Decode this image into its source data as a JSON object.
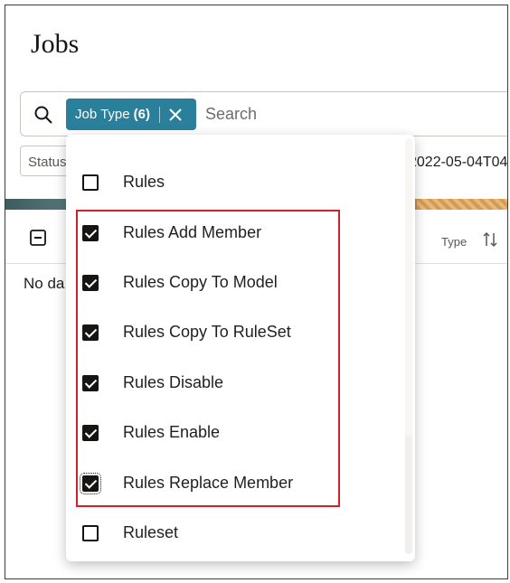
{
  "page": {
    "title": "Jobs"
  },
  "search": {
    "chip_label": "Job Type",
    "chip_count": "(6)",
    "placeholder": "Search"
  },
  "filters": {
    "status_label": "Status",
    "date_value": "2022-05-04T04"
  },
  "table": {
    "column_type": "Type",
    "no_data": "No da"
  },
  "dropdown": {
    "options": [
      {
        "label": "Rules",
        "checked": false
      },
      {
        "label": "Rules Add Member",
        "checked": true
      },
      {
        "label": "Rules Copy To Model",
        "checked": true
      },
      {
        "label": "Rules Copy To RuleSet",
        "checked": true
      },
      {
        "label": "Rules Disable",
        "checked": true
      },
      {
        "label": "Rules Enable",
        "checked": true
      },
      {
        "label": "Rules Replace Member",
        "checked": true
      },
      {
        "label": "Ruleset",
        "checked": false
      }
    ]
  },
  "colors": {
    "chip_bg": "#2a7f9a",
    "highlight_border": "#d0202a"
  }
}
